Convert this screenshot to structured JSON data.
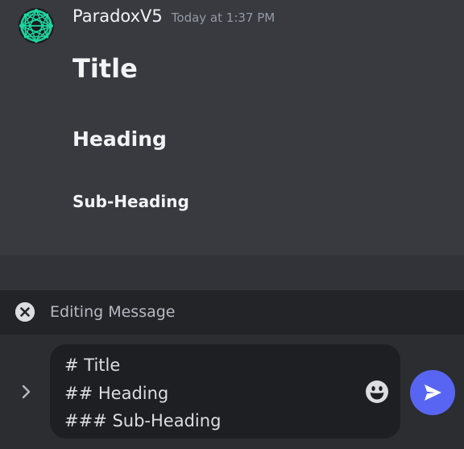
{
  "message": {
    "author": "ParadoxV5",
    "timestamp": "Today at 1:37 PM",
    "title": "Title",
    "heading": "Heading",
    "subheading": "Sub-Heading"
  },
  "editing_bar": {
    "label": "Editing Message"
  },
  "composer": {
    "lines": [
      "# Title",
      "## Heading",
      "### Sub-Heading"
    ]
  },
  "icons": {
    "avatar": "avatar-icon",
    "cancel": "close-circle-icon",
    "expand": "chevron-right-icon",
    "emoji": "emoji-smile-icon",
    "send": "send-icon"
  },
  "colors": {
    "accent": "#5865f2",
    "avatar_pattern": "#1fd6a1"
  }
}
